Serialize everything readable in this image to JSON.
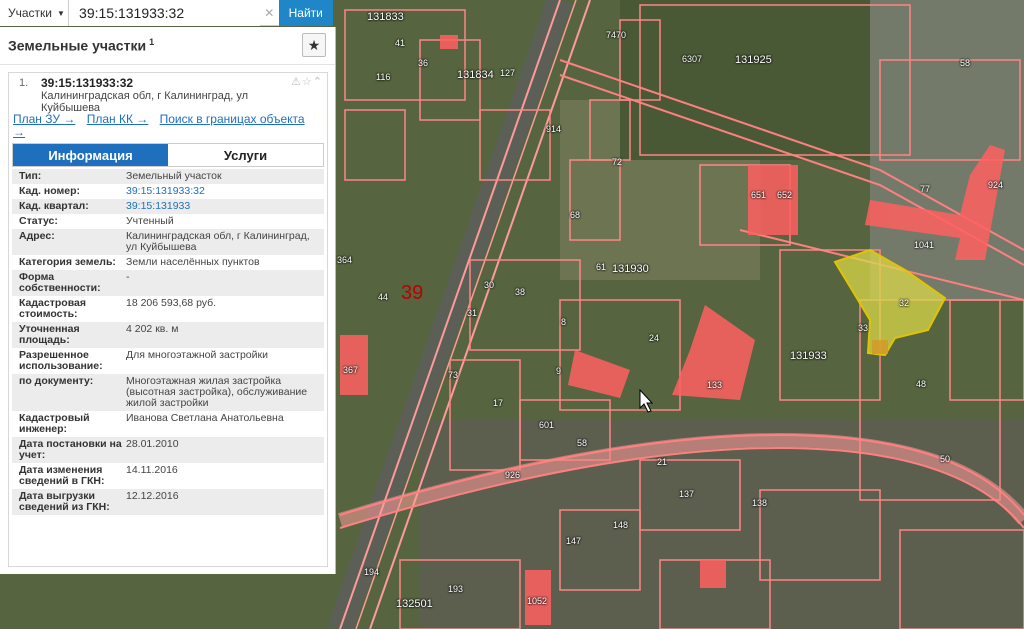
{
  "search": {
    "type_label": "Участки",
    "query": "39:15:131933:32",
    "find_label": "Найти"
  },
  "panel": {
    "title": "Земельные участки",
    "count": "1"
  },
  "result": {
    "index": "1.",
    "cad_number": "39:15:131933:32",
    "address_short": "Калининградская обл, г Калининград, ул Куйбышева",
    "links": [
      "План ЗУ →",
      "План КК →",
      "Поиск в границах объекта →"
    ],
    "tabs": [
      "Информация",
      "Услуги"
    ]
  },
  "info_rows": [
    {
      "key": "Тип:",
      "value": "Земельный участок"
    },
    {
      "key": "Кад. номер:",
      "value": "39:15:131933:32"
    },
    {
      "key": "Кад. квартал:",
      "value": "39:15:131933"
    },
    {
      "key": "Статус:",
      "value": "Учтенный"
    },
    {
      "key": "Адрес:",
      "value": "Калининградская обл, г Калининград, ул Куйбышева"
    },
    {
      "key": "Категория земель:",
      "value": "Земли населённых пунктов"
    },
    {
      "key": "Форма собственности:",
      "value": "-"
    },
    {
      "key": "Кадастровая стоимость:",
      "value": "18 206 593,68 руб."
    },
    {
      "key": "Уточненная площадь:",
      "value": "4 202 кв. м"
    },
    {
      "key": "Разрешенное использование:",
      "value": "Для многоэтажной застройки"
    },
    {
      "key": "по документу:",
      "value": "Многоэтажная жилая застройка (высотная застройка), обслуживание жилой застройки"
    },
    {
      "key": "Кадастровый инженер:",
      "value": "Иванова Светлана Анатольевна"
    },
    {
      "key": "Дата постановки на учет:",
      "value": "28.01.2010"
    },
    {
      "key": "Дата изменения сведений в ГКН:",
      "value": "14.11.2016"
    },
    {
      "key": "Дата выгрузки сведений из ГКН:",
      "value": "12.12.2016"
    }
  ],
  "map": {
    "labels": [
      "131833",
      "131834",
      "131925",
      "131930",
      "131933",
      "132501",
      "39",
      "7470",
      "6307",
      "914",
      "61",
      "68",
      "72",
      "38",
      "31",
      "24",
      "9",
      "8",
      "133",
      "32",
      "33",
      "48",
      "50",
      "651",
      "652",
      "77",
      "924",
      "1041",
      "58",
      "41",
      "116",
      "127",
      "44",
      "36",
      "21",
      "137",
      "138",
      "148",
      "147",
      "926",
      "194",
      "193",
      "601",
      "58",
      "73",
      "17",
      "364",
      "367",
      "1052",
      "30"
    ],
    "colors": {
      "boundary": "#ff8080",
      "building": "#ff5a5a",
      "selected": "#d8d84a"
    }
  }
}
